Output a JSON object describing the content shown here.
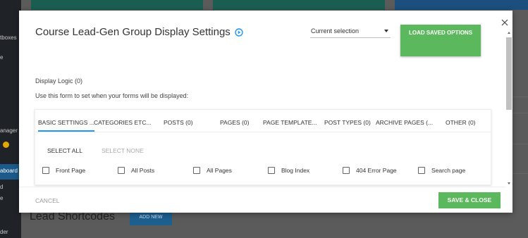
{
  "background": {
    "sidebar_items": [
      "tboxes",
      "e",
      "anager",
      "aboard",
      "d",
      "e",
      "der"
    ],
    "heading": "Lead Shortcodes",
    "add_button": "ADD NEW"
  },
  "modal": {
    "title": "Course Lead-Gen Group Display Settings",
    "selection": "Current selection",
    "load_button": "LOAD SAVED OPTIONS",
    "display_logic": "Display Logic (0)",
    "help_text": "Use this form to set when your forms will be displayed:",
    "tabs": [
      "BASIC SETTINGS ...",
      "CATEGORIES ETC...",
      "POSTS (0)",
      "PAGES (0)",
      "PAGE TEMPLATE...",
      "POST TYPES (0)",
      "ARCHIVE PAGES (...",
      "OTHER (0)"
    ],
    "select_all": "SELECT ALL",
    "select_none": "SELECT NONE",
    "checkboxes": [
      "Front Page",
      "All Posts",
      "All Pages",
      "Blog Index",
      "404 Error Page",
      "Search page"
    ],
    "cancel": "CANCEL",
    "save_close": "SAVE & CLOSE"
  },
  "colors": {
    "accent_green": "#5cb85c",
    "tab_underline": "#2196f3",
    "play_icon": "#2196f3"
  }
}
